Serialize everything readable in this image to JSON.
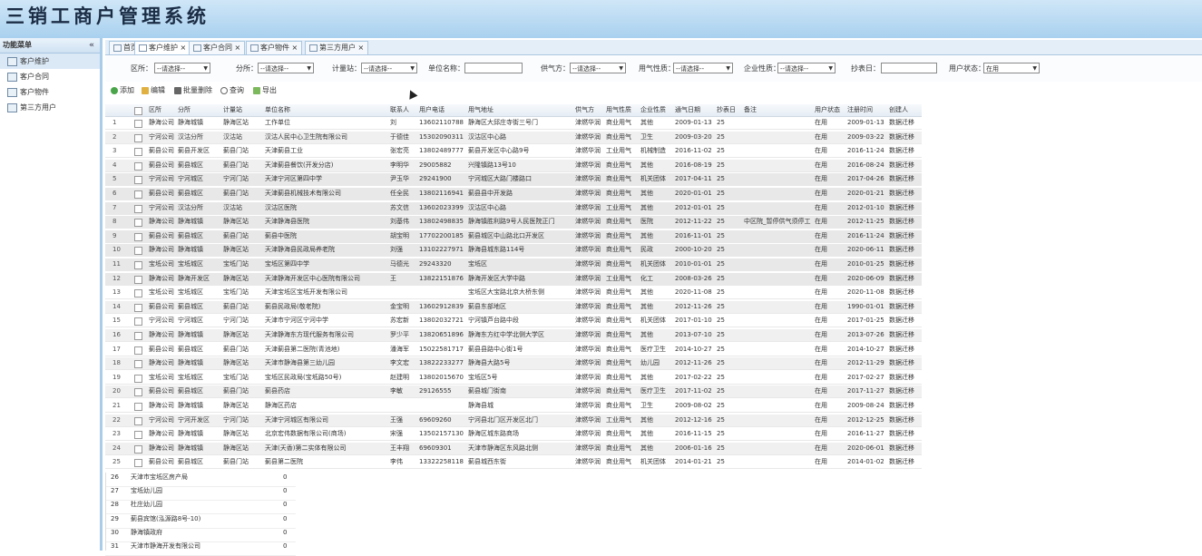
{
  "app": {
    "title": "三销工商户管理系统"
  },
  "sidebar": {
    "header": "功能菜单",
    "collapse_icon": "«",
    "items": [
      {
        "label": "客户维护",
        "active": true
      },
      {
        "label": "客户合同"
      },
      {
        "label": "客户物件"
      },
      {
        "label": "第三方用户"
      }
    ]
  },
  "tabs": [
    {
      "label": "首页"
    },
    {
      "label": "客户维护 ×",
      "active": true
    },
    {
      "label": "客户合同 ×"
    },
    {
      "label": "客户物件 ×"
    },
    {
      "label": "第三方用户 ×"
    }
  ],
  "filters": {
    "dept_label": "区所：",
    "dept_value": "--请选择--",
    "branch_label": "分所：",
    "branch_value": "--请选择--",
    "station_label": "计量站：",
    "station_value": "--请选择--",
    "unit_label": "单位名称：",
    "supply_label": "供气方：",
    "supply_value": "--请选择--",
    "usetype_label": "用气性质：",
    "usetype_value": "--请选择--",
    "bizprop_label": "企业性质：",
    "bizprop_value": "--请选择--",
    "readday_label": "抄表日：",
    "status_label": "用户状态：",
    "status_value": "在用"
  },
  "toolbar": {
    "add": "添加",
    "edit": "编辑",
    "batch_delete": "批量删除",
    "query": "查询",
    "export": "导出"
  },
  "columns": [
    "区所",
    "分所",
    "计量站",
    "单位名称",
    "联系人",
    "用户电话",
    "用气地址",
    "供气方",
    "用气性质",
    "企业性质",
    "通气日期",
    "抄表日",
    "备注",
    "用户状态",
    "注册时间",
    "创建人"
  ],
  "rows": [
    {
      "n": "1",
      "c": [
        "静海公司",
        "静海城镇",
        "静海区站",
        "工作单位",
        "刘",
        "13602110788",
        "静海区大邱庄寺街三号门",
        "津燃华润",
        "商业用气",
        "其他",
        "2009-01-13",
        "25",
        "",
        "在用",
        "2009-01-13",
        "数据迁移"
      ]
    },
    {
      "n": "2",
      "c": [
        "宁河公司",
        "汉沽分所",
        "汉沽站",
        "汉沽人民中心卫生院有限公司",
        "于德佳",
        "15302090311",
        "汉沽区中心路",
        "津燃华润",
        "商业用气",
        "卫生",
        "2009-03-20",
        "25",
        "",
        "在用",
        "2009-03-22",
        "数据迁移"
      ]
    },
    {
      "n": "3",
      "c": [
        "蓟县公司",
        "蓟县开发区",
        "蓟县门站",
        "天津蓟县工业",
        "张宏亮",
        "13802489777",
        "蓟县开发区中心路9号",
        "津燃华润",
        "工业用气",
        "机械制造",
        "2016-11-02",
        "25",
        "",
        "在用",
        "2016-11-24",
        "数据迁移"
      ]
    },
    {
      "n": "4",
      "c": [
        "蓟县公司",
        "蓟县城区",
        "蓟县门站",
        "天津蓟县餐饮(开发分店)",
        "李明华",
        "29005882",
        "兴隆镇路13号10",
        "津燃华润",
        "商业用气",
        "其他",
        "2016-08-19",
        "25",
        "",
        "在用",
        "2016-08-24",
        "数据迁移"
      ]
    },
    {
      "n": "5",
      "c": [
        "宁河公司",
        "宁河城区",
        "宁河门站",
        "天津宁河区第四中学",
        "尹玉华",
        "29241900",
        "宁河城区大路门楼路口",
        "津燃华润",
        "商业用气",
        "机关团体",
        "2017-04-11",
        "25",
        "",
        "在用",
        "2017-04-26",
        "数据迁移"
      ]
    },
    {
      "n": "6",
      "c": [
        "蓟县公司",
        "蓟县城区",
        "蓟县门站",
        "天津蓟县机械技术有限公司",
        "任全民",
        "13802116941",
        "蓟县县中开发路",
        "津燃华润",
        "商业用气",
        "其他",
        "2020-01-01",
        "25",
        "",
        "在用",
        "2020-01-21",
        "数据迁移"
      ]
    },
    {
      "n": "7",
      "c": [
        "宁河公司",
        "汉沽分所",
        "汉沽站",
        "汉沽区医院",
        "苏文信",
        "13602023399",
        "汉沽区中心路",
        "津燃华润",
        "工业用气",
        "其他",
        "2012-01-01",
        "25",
        "",
        "在用",
        "2012-01-10",
        "数据迁移"
      ]
    },
    {
      "n": "8",
      "c": [
        "静海公司",
        "静海城镇",
        "静海区站",
        "天津静海县医院",
        "刘基伟",
        "13802498835",
        "静海镇胜利路9号人民医院正门",
        "津燃华润",
        "商业用气",
        "医院",
        "2012-11-22",
        "25",
        "中区院_暂停供气须停工",
        "在用",
        "2012-11-25",
        "数据迁移"
      ]
    },
    {
      "n": "9",
      "c": [
        "蓟县公司",
        "蓟县城区",
        "蓟县门站",
        "蓟县中医院",
        "胡宝明",
        "17702200185",
        "蓟县城区中山路北口开发区",
        "津燃华润",
        "商业用气",
        "其他",
        "2016-11-01",
        "25",
        "",
        "在用",
        "2016-11-24",
        "数据迁移"
      ]
    },
    {
      "n": "10",
      "c": [
        "静海公司",
        "静海城镇",
        "静海区站",
        "天津静海县民政局养老院",
        "刘强",
        "13102227971",
        "静海县城东路114号",
        "津燃华润",
        "商业用气",
        "民政",
        "2000-10-20",
        "25",
        "",
        "在用",
        "2020-06-11",
        "数据迁移"
      ]
    },
    {
      "n": "11",
      "c": [
        "宝坻公司",
        "宝坻城区",
        "宝坻门站",
        "宝坻区第四中学",
        "马德光",
        "29243320",
        "宝坻区",
        "津燃华润",
        "商业用气",
        "机关团体",
        "2010-01-01",
        "25",
        "",
        "在用",
        "2010-01-25",
        "数据迁移"
      ]
    },
    {
      "n": "12",
      "c": [
        "静海公司",
        "静海开发区",
        "静海区站",
        "天津静海开发区中心医院有限公司",
        "王",
        "13822151876",
        "静海开发区大学中路",
        "津燃华润",
        "工业用气",
        "化工",
        "2008-03-26",
        "25",
        "",
        "在用",
        "2020-06-09",
        "数据迁移"
      ]
    },
    {
      "n": "13",
      "c": [
        "宝坻公司",
        "宝坻城区",
        "宝坻门站",
        "天津宝坻区宝坻开发有限公司",
        "",
        "",
        "宝坻区大宝路北京大桥东侧",
        "津燃华润",
        "商业用气",
        "其他",
        "2020-11-08",
        "25",
        "",
        "在用",
        "2020-11-08",
        "数据迁移"
      ]
    },
    {
      "n": "14",
      "c": [
        "蓟县公司",
        "蓟县城区",
        "蓟县门站",
        "蓟县民政局(敬老院)",
        "金宝明",
        "13602912839",
        "蓟县东部地区",
        "津燃华润",
        "商业用气",
        "其他",
        "2012-11-26",
        "25",
        "",
        "在用",
        "1990-01-01",
        "数据迁移"
      ]
    },
    {
      "n": "15",
      "c": [
        "宁河公司",
        "宁河城区",
        "宁河门站",
        "天津市宁河区宁河中学",
        "苏宏新",
        "13802032721",
        "宁河镇芦台路中段",
        "津燃华润",
        "商业用气",
        "机关团体",
        "2017-01-10",
        "25",
        "",
        "在用",
        "2017-01-25",
        "数据迁移"
      ]
    },
    {
      "n": "16",
      "c": [
        "静海公司",
        "静海城镇",
        "静海区站",
        "天津静海东方现代服务有限公司",
        "罗少平",
        "13820651896",
        "静海东方红中学北侧大学区",
        "津燃华润",
        "商业用气",
        "其他",
        "2013-07-10",
        "25",
        "",
        "在用",
        "2013-07-26",
        "数据迁移"
      ]
    },
    {
      "n": "17",
      "c": [
        "蓟县公司",
        "蓟县城区",
        "蓟县门站",
        "天津蓟县第二医院(青池地)",
        "潘海军",
        "15022581717",
        "蓟县县路中心街1号",
        "津燃华润",
        "商业用气",
        "医疗卫生",
        "2014-10-27",
        "25",
        "",
        "在用",
        "2014-10-27",
        "数据迁移"
      ]
    },
    {
      "n": "18",
      "c": [
        "静海公司",
        "静海城镇",
        "静海区站",
        "天津市静海县第三幼儿园",
        "李文宏",
        "13822233277",
        "静海县大路5号",
        "津燃华润",
        "商业用气",
        "幼儿园",
        "2012-11-26",
        "25",
        "",
        "在用",
        "2012-11-29",
        "数据迁移"
      ]
    },
    {
      "n": "19",
      "c": [
        "宝坻公司",
        "宝坻城区",
        "宝坻门站",
        "宝坻区民政局(宝坻路50号)",
        "赵建明",
        "13802015670",
        "宝坻区5号",
        "津燃华润",
        "商业用气",
        "其他",
        "2017-02-22",
        "25",
        "",
        "在用",
        "2017-02-27",
        "数据迁移"
      ]
    },
    {
      "n": "20",
      "c": [
        "蓟县公司",
        "蓟县城区",
        "蓟县门站",
        "蓟县药店",
        "李敏",
        "29126555",
        "蓟县城门街南",
        "津燃华润",
        "商业用气",
        "医疗卫生",
        "2017-11-02",
        "25",
        "",
        "在用",
        "2017-11-27",
        "数据迁移"
      ]
    },
    {
      "n": "21",
      "c": [
        "静海公司",
        "静海城镇",
        "静海区站",
        "静海区药店",
        "",
        "",
        "静海县城",
        "津燃华润",
        "商业用气",
        "卫生",
        "2009-08-02",
        "25",
        "",
        "在用",
        "2009-08-24",
        "数据迁移"
      ]
    },
    {
      "n": "22",
      "c": [
        "宁河公司",
        "宁河开发区",
        "宁河门站",
        "天津宁河城区有限公司",
        "王强",
        "69609260",
        "宁河县北门区开发区北门",
        "津燃华润",
        "工业用气",
        "其他",
        "2012-12-16",
        "25",
        "",
        "在用",
        "2012-12-25",
        "数据迁移"
      ]
    },
    {
      "n": "23",
      "c": [
        "静海公司",
        "静海城镇",
        "静海区站",
        "北京宏伟数据有限公司(商场)",
        "宋强",
        "13502157130",
        "静海区城东路商场",
        "津燃华润",
        "商业用气",
        "其他",
        "2016-11-15",
        "25",
        "",
        "在用",
        "2016-11-27",
        "数据迁移"
      ]
    },
    {
      "n": "24",
      "c": [
        "静海公司",
        "静海城镇",
        "静海区站",
        "天津(天香)第二实体有限公司",
        "王丰翔",
        "69609301",
        "天津市静海区东风路北侧",
        "津燃华润",
        "商业用气",
        "其他",
        "2006-01-16",
        "25",
        "",
        "在用",
        "2020-06-01",
        "数据迁移"
      ]
    },
    {
      "n": "25",
      "c": [
        "蓟县公司",
        "蓟县城区",
        "蓟县门站",
        "蓟县第二医院",
        "李伟",
        "13322258118",
        "蓟县城西东街",
        "津燃华润",
        "商业用气",
        "机关团体",
        "2014-01-21",
        "25",
        "",
        "在用",
        "2014-01-02",
        "数据迁移"
      ]
    }
  ],
  "extra_rows": [
    {
      "n": "26",
      "label": "天津市宝坻区房产局",
      "v": "0"
    },
    {
      "n": "27",
      "label": "宝坻幼儿园",
      "v": "0"
    },
    {
      "n": "28",
      "label": "杜庄幼儿园",
      "v": "0"
    },
    {
      "n": "29",
      "label": "蓟县宾馆(泓源路8号-10)",
      "v": "0"
    },
    {
      "n": "30",
      "label": "静海镇政府",
      "v": "0"
    },
    {
      "n": "31",
      "label": "天津市静海开发有限公司",
      "v": "0"
    }
  ]
}
